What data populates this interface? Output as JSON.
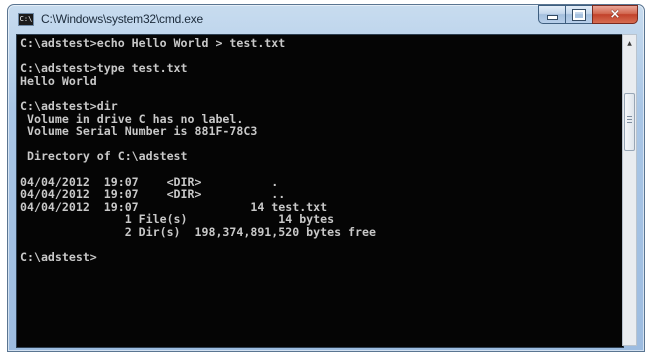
{
  "window": {
    "title": "C:\\Windows\\system32\\cmd.exe",
    "icon": "command-prompt-icon",
    "buttons": {
      "minimize": "minimize-icon",
      "maximize": "maximize-icon",
      "close": "close-icon",
      "close_glyph": "×"
    }
  },
  "console": {
    "lines": [
      "C:\\adstest>echo Hello World > test.txt",
      "",
      "C:\\adstest>type test.txt",
      "Hello World",
      "",
      "C:\\adstest>dir",
      " Volume in drive C has no label.",
      " Volume Serial Number is 881F-78C3",
      "",
      " Directory of C:\\adstest",
      "",
      "04/04/2012  19:07    <DIR>          .",
      "04/04/2012  19:07    <DIR>          ..",
      "04/04/2012  19:07                14 test.txt",
      "               1 File(s)             14 bytes",
      "               2 Dir(s)  198,374,891,520 bytes free",
      "",
      "C:\\adstest>"
    ]
  },
  "scrollbar": {
    "up_arrow": "▲",
    "up_icon": "scroll-up-arrow-icon"
  },
  "colors": {
    "console_background": "#050505",
    "console_text": "#c8c8c8",
    "titlebar": "#a9c6e6",
    "close_button": "#c2412a"
  }
}
